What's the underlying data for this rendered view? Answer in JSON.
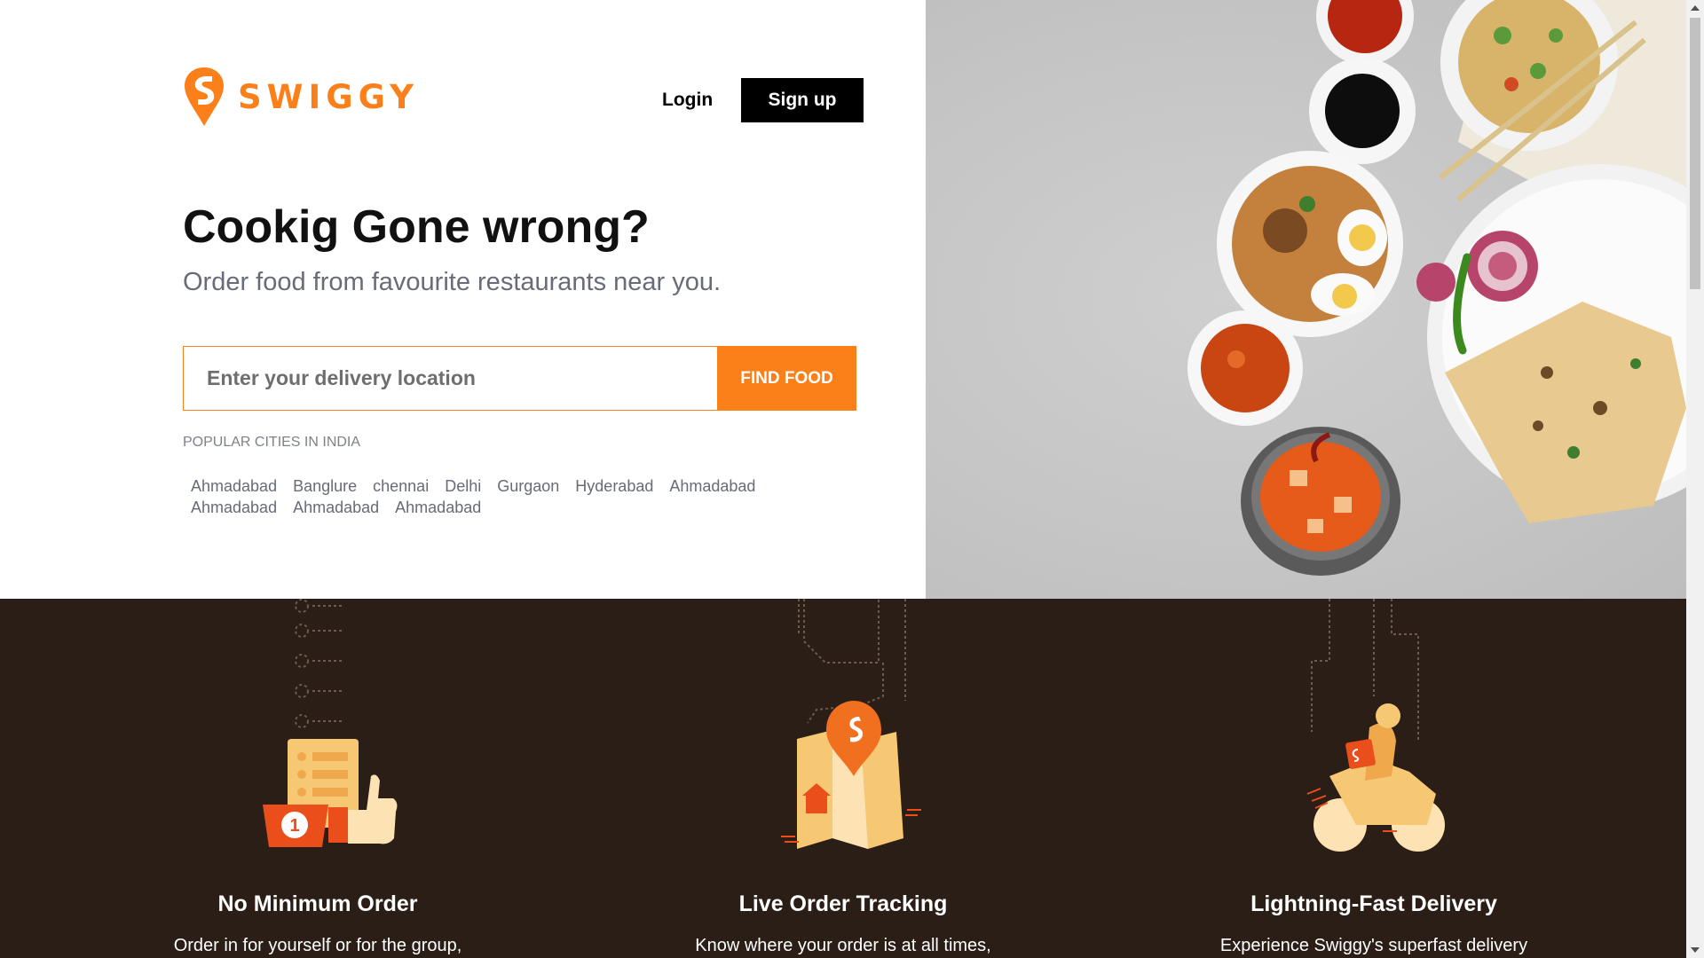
{
  "brand": {
    "name": "SWIGGY",
    "color": "#fc8019",
    "icon": "swiggy-pin-logo"
  },
  "header": {
    "login_label": "Login",
    "signup_label": "Sign up"
  },
  "hero": {
    "title": "Cookig Gone wrong?",
    "subtitle": "Order food from favourite restaurants near you.",
    "search": {
      "placeholder": "Enter your delivery location",
      "value": "",
      "button_label": "FIND FOOD"
    }
  },
  "popular_cities": {
    "heading": "POPULAR CITIES IN INDIA",
    "items": [
      "Ahmadabad",
      "Banglure",
      "chennai",
      "Delhi",
      "Gurgaon",
      "Hyderabad",
      "Ahmadabad",
      "Ahmadabad",
      "Ahmadabad",
      "Ahmadabad"
    ]
  },
  "features": [
    {
      "title": "No Minimum Order",
      "description": "Order in for yourself or for the group,",
      "icon": "order-checklist-thumbs-up-icon"
    },
    {
      "title": "Live Order Tracking",
      "description": "Know where your order is at all times,",
      "icon": "map-location-pin-icon"
    },
    {
      "title": "Lightning-Fast Delivery",
      "description": "Experience Swiggy's superfast delivery",
      "icon": "delivery-scooter-icon"
    }
  ],
  "colors": {
    "accent": "#fc8019",
    "features_bg": "#2b1e16",
    "art_light": "#f7c873",
    "art_mid": "#f0a84d",
    "art_red": "#e94e1b"
  }
}
